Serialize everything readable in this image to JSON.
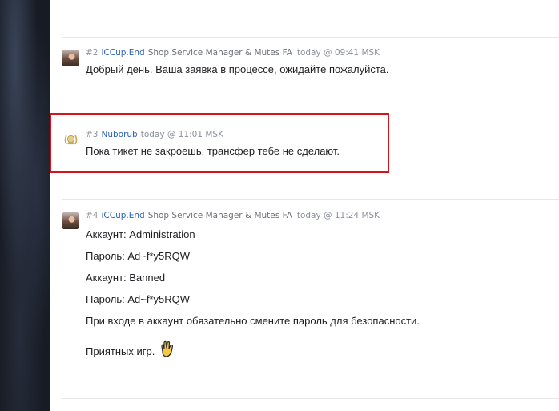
{
  "posts": [
    {
      "num": "#2",
      "user": "iCCup.End",
      "role": "Shop Service Manager & Mutes FA",
      "time": "today @ 09:41 MSK",
      "lines": [
        "Добрый день. Ваша заявка в процессе, ожидайте пожалуйста."
      ]
    },
    {
      "num": "#3",
      "user": "Nuborub",
      "role": "",
      "time": "today @ 11:01 MSK",
      "lines": [
        "Пока тикет не закроешь, трансфер тебе не сделают."
      ]
    },
    {
      "num": "#4",
      "user": "iCCup.End",
      "role": "Shop Service Manager & Mutes FA",
      "time": "today @ 11:24 MSK",
      "lines": [
        "Аккаунт: Administration",
        "Пароль: Ad~f*y5RQW",
        "Аккаунт: Banned",
        "Пароль: Ad~f*y5RQW",
        "При входе в аккаунт обязательно смените пароль для безопасности.",
        "Приятных игр."
      ]
    }
  ],
  "colors": {
    "username": "#2d63b7",
    "highlight_border": "#d8141b",
    "sidebar_bg": "#171b24"
  },
  "icons": {
    "post4_emoji": "waving-hand-emoji-icon"
  }
}
